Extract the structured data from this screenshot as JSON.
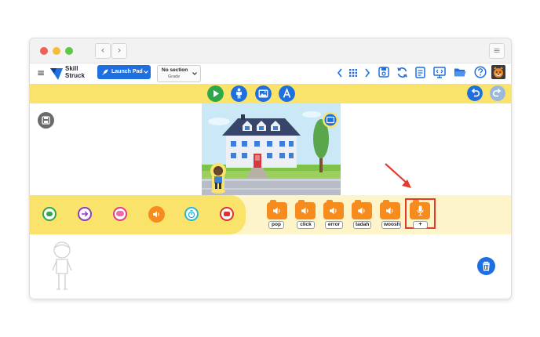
{
  "browser": {
    "back_glyph": "‹",
    "forward_glyph": "›",
    "menu_glyph": "≡"
  },
  "app": {
    "menu_glyph": "≡",
    "logo_line1": "Skill",
    "logo_line2": "Struck",
    "launch_pad_label": "Launch Pad",
    "section_title": "No section",
    "section_sub": "Grade"
  },
  "sound_blocks": [
    "pop",
    "click",
    "error",
    "tadah",
    "woosh"
  ],
  "record_block": {
    "label": "+"
  },
  "colors": {
    "toolbar_yellow": "#f9e36a",
    "tray_light": "#fdf4c9",
    "primary_blue": "#1e6fe0",
    "block_orange": "#f68c1e",
    "highlight_red": "#e53b2c"
  }
}
